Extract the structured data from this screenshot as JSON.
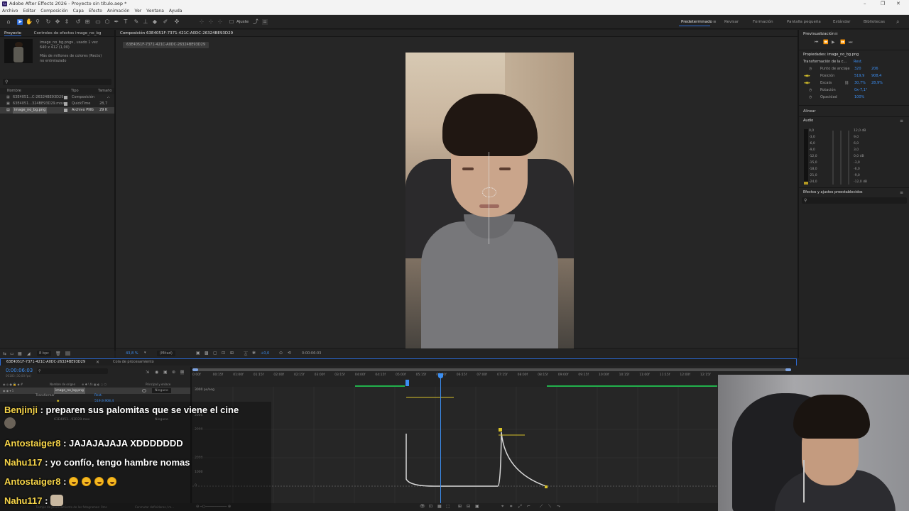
{
  "window": {
    "title": "Adobe After Effects 2026 - Proyecto sin título.aep *",
    "app_icon": "Ae",
    "minimize": "–",
    "maximize": "❐",
    "close": "✕"
  },
  "menu": [
    "Archivo",
    "Editar",
    "Composición",
    "Capa",
    "Efecto",
    "Animación",
    "Ver",
    "Ventana",
    "Ayuda"
  ],
  "toolbar": {
    "snap_label": "Ajuste",
    "workspaces": [
      "Predeterminado",
      "Revisar",
      "Formación",
      "Pantalla pequeña",
      "Estándar",
      "Bibliotecas"
    ],
    "active_workspace": "Predeterminado",
    "search_icon": "⌕"
  },
  "project": {
    "tab_project": "Proyecto",
    "tab_effects": "Controles de efectos image_no_bg",
    "item_name": "image_no_bg.png▾ , usado 1 vez",
    "item_size": "640 x 412 (1,00)",
    "item_colors": "Más de millones de colores (Recto)",
    "item_interp": "no entrelazado",
    "search_placeholder": "",
    "col_name": "Nombre",
    "col_type": "Tipo",
    "col_size": "Tamaño",
    "items": [
      {
        "name": "63E4051...C-26324BE93D29",
        "type": "Composición",
        "size": ""
      },
      {
        "name": "63E4051...324BE93D29.mov",
        "type": "QuickTime",
        "size": "28,7"
      },
      {
        "name": "image_no_bg.png",
        "type": "Archivo PNG",
        "size": "29 K"
      }
    ],
    "bpc": "8 bpc"
  },
  "composition": {
    "tab": "Composición 63E4051F-7371-421C-A0DC-26324BE93D29",
    "subtab": "63E4051F-7371-421C-A0DC-26324BE93D29",
    "zoom": "43,8 %",
    "resolution": "(Mitad)",
    "exposure": "+0,0",
    "timecode": "0:00:06:03"
  },
  "right": {
    "preview_title": "Previsualización",
    "props_title": "Propiedades: image_no_bg.png",
    "transform_label": "Transformación de la c...",
    "reset": "Rest.",
    "props": [
      {
        "label": "Punto de anclaje",
        "v1": "320",
        "v2": "206"
      },
      {
        "label": "Posición",
        "v1": "519,9",
        "v2": "908,4"
      },
      {
        "label": "Escala",
        "v1": "30,7%",
        "v2": "28,9%"
      },
      {
        "label": "Rotación",
        "v1": "0x-7,1°",
        "v2": ""
      },
      {
        "label": "Opacidad",
        "v1": "100%",
        "v2": ""
      }
    ],
    "align_title": "Alinear",
    "audio_title": "Audio",
    "audio_left": [
      "0,0",
      "-3,0",
      "-6,0",
      "-9,0",
      "-12,0",
      "-15,0",
      "-18,0",
      "-21,0",
      "-24,0"
    ],
    "audio_right": [
      "12,0 dB",
      "9,0",
      "6,0",
      "3,0",
      "0,0 dB",
      "-3,0",
      "-6,0",
      "-9,0",
      "-12,0 dB"
    ],
    "effects_title": "Efectos y ajustes preestablecidos"
  },
  "timeline": {
    "comp_tab": "63E4051F-7371-421C-A0DC-26324BE93D29",
    "render_tab": "Cola de procesamiento",
    "timecode": "0:00:06:03",
    "fps": "00183 (30,00 fps)",
    "col_source": "Nombre de origen",
    "col_parent": "Principal y enlace",
    "layer1": "image_no_bg.png",
    "layer1_parent": "Ninguno",
    "layer1_sub": "Transformar",
    "layer1_reset": "Rest.",
    "layer1_pos": "519,9,908,4",
    "layer2": "63E4051...93D29.mov",
    "layer2_parent": "Ninguno",
    "graph_top_label": "3000 px/seg",
    "graph_labels": [
      "2000",
      "3000",
      "2000",
      "1000",
      "0"
    ],
    "ticks": [
      "0:00f",
      "00:15f",
      "01:00f",
      "01:15f",
      "02:00f",
      "02:15f",
      "03:00f",
      "03:15f",
      "04:00f",
      "04:15f",
      "05:00f",
      "05:15f",
      "06:00f",
      "06:15f",
      "07:00f",
      "07:15f",
      "08:00f",
      "08:15f",
      "09:00f",
      "09:15f",
      "10:00f",
      "10:15f",
      "11:00f",
      "11:15f",
      "12:00f",
      "12:15f"
    ],
    "status_left": "Tiempo de procesamiento de los fotogramas: 0ms",
    "status_mid": "Conmutar definidores / m..."
  },
  "chat": [
    {
      "user": "Benjinji",
      "message": ": preparen sus palomitas que se viene el cine"
    },
    {
      "user": "Antostaiger8",
      "message": ": JAJAJAJAJA XDDDDDDD"
    },
    {
      "user": "Nahu117",
      "message": ": yo confío, tengo hambre nomas"
    },
    {
      "user": "Antostaiger8",
      "message": ":",
      "emoji_count": 4
    },
    {
      "user": "Nahu117",
      "message": ":"
    }
  ],
  "colors": {
    "accent": "#2d6bd5",
    "value_blue": "#3b8ef2",
    "keyframe": "#d8c22a",
    "work_area": "#22b14c",
    "chat_user": "#f7d54a",
    "playhead": "#3b8ef2"
  }
}
